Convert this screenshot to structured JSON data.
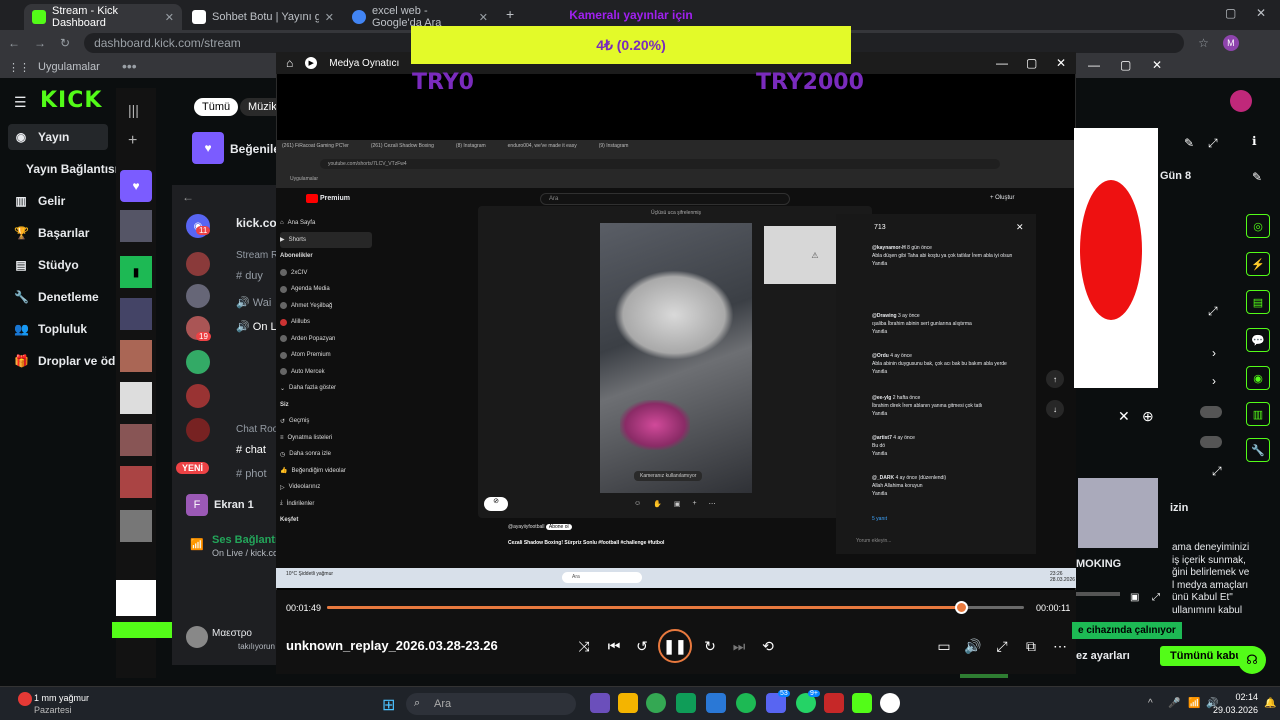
{
  "browser": {
    "tabs": [
      {
        "title": "Stream - Kick Dashboard",
        "active": true
      },
      {
        "title": "Sohbet Botu | Yayını güçlendi",
        "active": false
      },
      {
        "title": "excel web - Google'da Ara",
        "active": false
      }
    ],
    "url": "dashboard.kick.com/stream",
    "bookmarks": [
      "Uygulamalar"
    ],
    "profile_initial": "M"
  },
  "kick": {
    "logo": "KICK",
    "nav": [
      {
        "label": "Yayın",
        "icon": "broadcast-icon"
      },
      {
        "label": "Yayın Bağlantısı",
        "icon": ""
      },
      {
        "label": "Gelir",
        "icon": "chart-icon"
      },
      {
        "label": "Başarılar",
        "icon": "trophy-icon"
      },
      {
        "label": "Stüdyo",
        "icon": "studio-icon"
      },
      {
        "label": "Denetleme",
        "icon": "wrench-icon"
      },
      {
        "label": "Topluluk",
        "icon": "people-icon"
      },
      {
        "label": "Droplar ve öd",
        "icon": "gift-icon"
      }
    ],
    "filter_tabs": [
      "Tümü",
      "Müzik"
    ],
    "liked_label": "Beğenilen Ş",
    "right_items": [
      "Gün 8",
      "izin",
      "MOKING",
      "e cihazında çalınıyor",
      "ez ayarları",
      "Tümünü kabul"
    ],
    "right_text": [
      "ama deneyiminizi",
      "iş içerik sunmak,",
      "ğini belirlemek ve",
      "l medya amaçları",
      "ünü Kabul Et\"",
      "ullanımını kabul"
    ]
  },
  "discord": {
    "server": "kick.com",
    "stream_room": "Stream R",
    "channels": [
      "duy",
      "Wai",
      "On L"
    ],
    "chat_room": "Chat Roo",
    "chat_channels": [
      "chat",
      "phot"
    ],
    "new_badge": "YENİ",
    "screen_share": "Ekran 1",
    "voice_title": "Ses Bağlantısı",
    "voice_sub": "On Live / kick.com",
    "user_name": "Μαεστρο",
    "user_status": "takılıyorun",
    "badge_11": "11",
    "badge_19": "19"
  },
  "player": {
    "window_title": "Medya Oynatıcı",
    "overlay_title": "Kameralı yayınlar için",
    "overlay_value": "4₺ (0.20%)",
    "try_left": "TRY0",
    "try_right": "TRY2000",
    "time_elapsed": "00:01:49",
    "time_remaining": "00:00:11",
    "progress": 0.91,
    "filename": "unknown_replay_2026.03.28-23.26"
  },
  "inner": {
    "tabs": [
      "(261) FiRacoat Gaming PC'ler",
      "(261) Cezali Shadow Boxing",
      "(8) Instagram",
      "enduro004, we've made it easy",
      "(9) Instagram"
    ],
    "url": "youtube.com/shorts/7LCV_VTzFw4",
    "bookmarks": "Uygulamalar",
    "search_placeholder": "Ara",
    "create_label": "Oluştur",
    "yt_nav": [
      "Ana Sayfa",
      "Shorts"
    ],
    "subs_title": "Abonelikler",
    "subs": [
      "2xCIV",
      "Agenda Media",
      "Ahmet Yeşilbağ",
      "Alillubs",
      "Arden Popazyan",
      "Atom Premium",
      "Auto Mercek",
      "Daha fazla göster"
    ],
    "you_title": "Siz",
    "you_items": [
      "Geçmiş",
      "Oynatma listeleri",
      "Daha sonra izle",
      "Beğendiğim videolar",
      "Videolarınız",
      "İndirilenler"
    ],
    "explore": "Keşfet",
    "call_title": "Üçlüsü uca şifrelenmiş",
    "camera_notice": "Kameranız kullanılamıyor",
    "short_channel": "@ayayiiyfootball",
    "short_subscribe": "Abone ol",
    "short_title": "Cezali Shadow Boxing! Sürpriz Sonlu #football #challenge #futbol",
    "comment_count": "713",
    "reply_label": "Yanıtla",
    "comments": [
      {
        "user": "@kaynamor-H",
        "time": "8 gün önce",
        "text": "Abla düşen gibi Taha abi koştu ya çok tatlılar İrem abla iyi olsun"
      },
      {
        "user": "@Drawing",
        "time": "3 ay önce",
        "text": "ışaliba İbrahim abinin sert gunlarına alıştırma"
      },
      {
        "user": "@Ordu",
        "time": "4 ay önce",
        "text": "Abla abinin duygusunu bak, çok acı bak bu bakım abla yerde"
      },
      {
        "user": "@ee-ylg",
        "time": "2 hafta önce",
        "text": "İbrahim direk İrem ablanın yanına gitmesi çok tatlı"
      },
      {
        "user": "@artist7",
        "time": "4 ay önce",
        "text": "Bu dö"
      },
      {
        "user": "@_DARK",
        "time": "4 ay önce (düzenlendi)",
        "text": "Allah Allahima koruyun"
      }
    ],
    "replies_count": "5 yanıt",
    "comment_placeholder": "Yorum ekleyin...",
    "weather": "10°C Şiddetli yağmur",
    "taskbar_search": "Ara",
    "clock": "23:26 28.03.2026"
  },
  "taskbar": {
    "weather_temp": "1 mm yağmur",
    "weather_day": "Pazartesi",
    "search_placeholder": "Ara",
    "time": "02:14",
    "date": "29.03.2026",
    "badge_53": "53",
    "badge_9": "9+"
  },
  "colors": {
    "kick_green": "#53fc18",
    "seek_orange": "#e8793e",
    "overlay_yellow": "#e3fa29",
    "overlay_purple": "#7a2bbd"
  }
}
